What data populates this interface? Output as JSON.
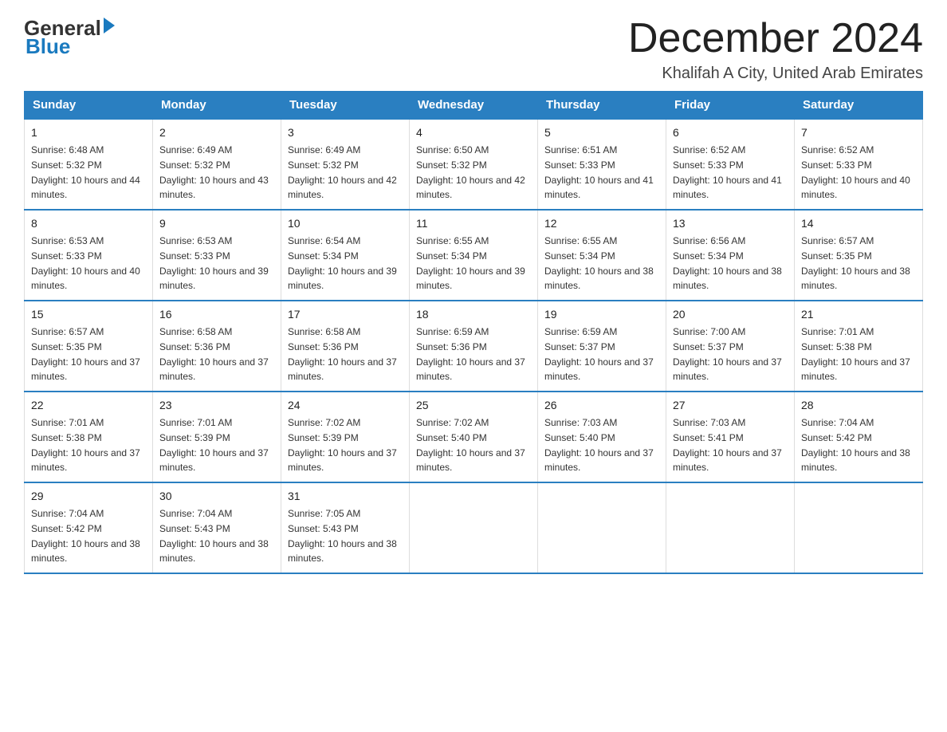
{
  "header": {
    "logo_general": "General",
    "logo_blue": "Blue",
    "month_title": "December 2024",
    "subtitle": "Khalifah A City, United Arab Emirates"
  },
  "days_of_week": [
    "Sunday",
    "Monday",
    "Tuesday",
    "Wednesday",
    "Thursday",
    "Friday",
    "Saturday"
  ],
  "weeks": [
    [
      {
        "day": "1",
        "sunrise": "6:48 AM",
        "sunset": "5:32 PM",
        "daylight": "10 hours and 44 minutes."
      },
      {
        "day": "2",
        "sunrise": "6:49 AM",
        "sunset": "5:32 PM",
        "daylight": "10 hours and 43 minutes."
      },
      {
        "day": "3",
        "sunrise": "6:49 AM",
        "sunset": "5:32 PM",
        "daylight": "10 hours and 42 minutes."
      },
      {
        "day": "4",
        "sunrise": "6:50 AM",
        "sunset": "5:32 PM",
        "daylight": "10 hours and 42 minutes."
      },
      {
        "day": "5",
        "sunrise": "6:51 AM",
        "sunset": "5:33 PM",
        "daylight": "10 hours and 41 minutes."
      },
      {
        "day": "6",
        "sunrise": "6:52 AM",
        "sunset": "5:33 PM",
        "daylight": "10 hours and 41 minutes."
      },
      {
        "day": "7",
        "sunrise": "6:52 AM",
        "sunset": "5:33 PM",
        "daylight": "10 hours and 40 minutes."
      }
    ],
    [
      {
        "day": "8",
        "sunrise": "6:53 AM",
        "sunset": "5:33 PM",
        "daylight": "10 hours and 40 minutes."
      },
      {
        "day": "9",
        "sunrise": "6:53 AM",
        "sunset": "5:33 PM",
        "daylight": "10 hours and 39 minutes."
      },
      {
        "day": "10",
        "sunrise": "6:54 AM",
        "sunset": "5:34 PM",
        "daylight": "10 hours and 39 minutes."
      },
      {
        "day": "11",
        "sunrise": "6:55 AM",
        "sunset": "5:34 PM",
        "daylight": "10 hours and 39 minutes."
      },
      {
        "day": "12",
        "sunrise": "6:55 AM",
        "sunset": "5:34 PM",
        "daylight": "10 hours and 38 minutes."
      },
      {
        "day": "13",
        "sunrise": "6:56 AM",
        "sunset": "5:34 PM",
        "daylight": "10 hours and 38 minutes."
      },
      {
        "day": "14",
        "sunrise": "6:57 AM",
        "sunset": "5:35 PM",
        "daylight": "10 hours and 38 minutes."
      }
    ],
    [
      {
        "day": "15",
        "sunrise": "6:57 AM",
        "sunset": "5:35 PM",
        "daylight": "10 hours and 37 minutes."
      },
      {
        "day": "16",
        "sunrise": "6:58 AM",
        "sunset": "5:36 PM",
        "daylight": "10 hours and 37 minutes."
      },
      {
        "day": "17",
        "sunrise": "6:58 AM",
        "sunset": "5:36 PM",
        "daylight": "10 hours and 37 minutes."
      },
      {
        "day": "18",
        "sunrise": "6:59 AM",
        "sunset": "5:36 PM",
        "daylight": "10 hours and 37 minutes."
      },
      {
        "day": "19",
        "sunrise": "6:59 AM",
        "sunset": "5:37 PM",
        "daylight": "10 hours and 37 minutes."
      },
      {
        "day": "20",
        "sunrise": "7:00 AM",
        "sunset": "5:37 PM",
        "daylight": "10 hours and 37 minutes."
      },
      {
        "day": "21",
        "sunrise": "7:01 AM",
        "sunset": "5:38 PM",
        "daylight": "10 hours and 37 minutes."
      }
    ],
    [
      {
        "day": "22",
        "sunrise": "7:01 AM",
        "sunset": "5:38 PM",
        "daylight": "10 hours and 37 minutes."
      },
      {
        "day": "23",
        "sunrise": "7:01 AM",
        "sunset": "5:39 PM",
        "daylight": "10 hours and 37 minutes."
      },
      {
        "day": "24",
        "sunrise": "7:02 AM",
        "sunset": "5:39 PM",
        "daylight": "10 hours and 37 minutes."
      },
      {
        "day": "25",
        "sunrise": "7:02 AM",
        "sunset": "5:40 PM",
        "daylight": "10 hours and 37 minutes."
      },
      {
        "day": "26",
        "sunrise": "7:03 AM",
        "sunset": "5:40 PM",
        "daylight": "10 hours and 37 minutes."
      },
      {
        "day": "27",
        "sunrise": "7:03 AM",
        "sunset": "5:41 PM",
        "daylight": "10 hours and 37 minutes."
      },
      {
        "day": "28",
        "sunrise": "7:04 AM",
        "sunset": "5:42 PM",
        "daylight": "10 hours and 38 minutes."
      }
    ],
    [
      {
        "day": "29",
        "sunrise": "7:04 AM",
        "sunset": "5:42 PM",
        "daylight": "10 hours and 38 minutes."
      },
      {
        "day": "30",
        "sunrise": "7:04 AM",
        "sunset": "5:43 PM",
        "daylight": "10 hours and 38 minutes."
      },
      {
        "day": "31",
        "sunrise": "7:05 AM",
        "sunset": "5:43 PM",
        "daylight": "10 hours and 38 minutes."
      },
      null,
      null,
      null,
      null
    ]
  ]
}
